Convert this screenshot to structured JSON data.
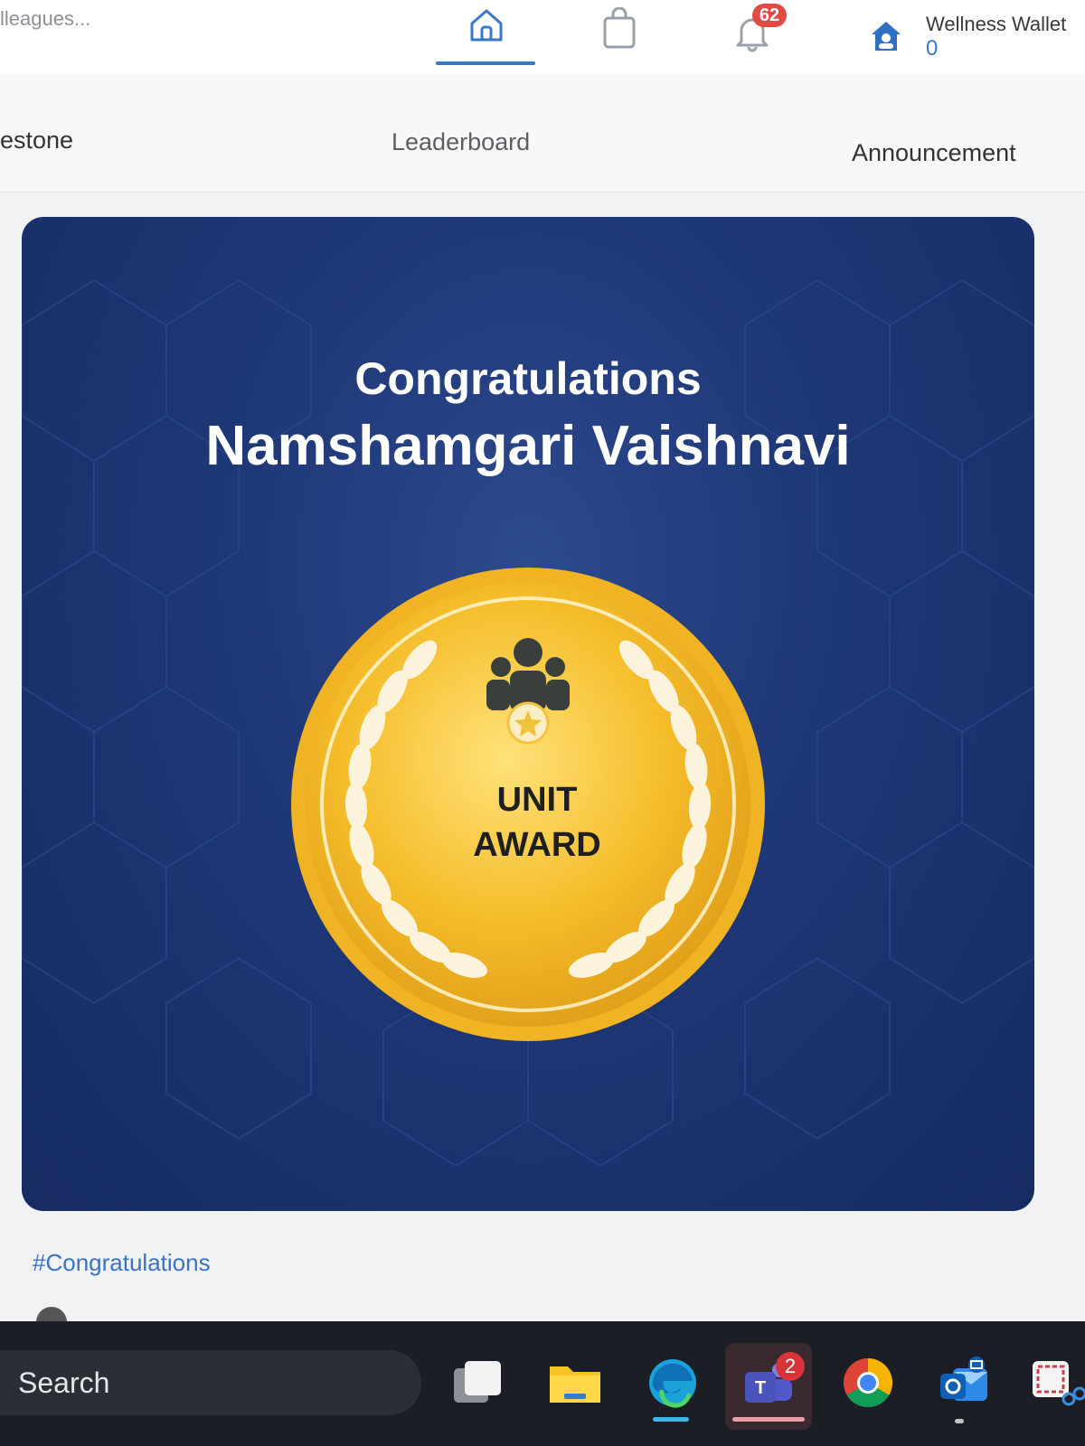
{
  "topbar": {
    "search_hint": "lleagues...",
    "notification_count": "62",
    "wallet_title": "Wellness Wallet",
    "wallet_value": "0"
  },
  "tabs": {
    "milestone": "estone",
    "leaderboard": "Leaderboard",
    "announcement": "Announcement"
  },
  "award_card": {
    "heading": "Congratulations",
    "recipient": "Namshamgari Vaishnavi",
    "medal_line1": "UNIT",
    "medal_line2": "AWARD",
    "background_color": "#1f3877",
    "medal_color": "#f2b722"
  },
  "post": {
    "hashtag": "#Congratulations"
  },
  "taskbar": {
    "search_label": "Search",
    "teams_badge": "2",
    "apps": [
      "task-view",
      "file-explorer",
      "edge",
      "teams",
      "chrome",
      "outlook",
      "snipping-tool"
    ]
  }
}
